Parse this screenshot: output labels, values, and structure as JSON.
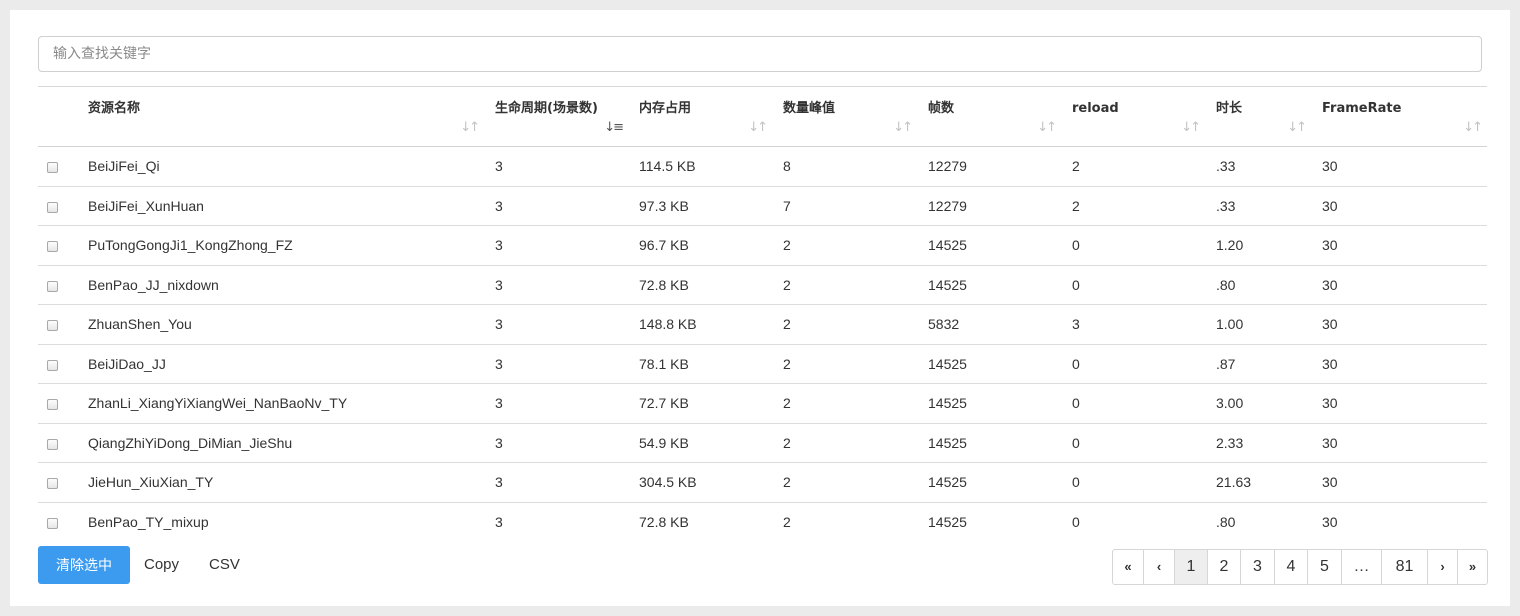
{
  "search": {
    "placeholder": "输入查找关键字"
  },
  "columns": [
    {
      "label": "资源名称"
    },
    {
      "label": "生命周期(场景数)"
    },
    {
      "label": "内存占用"
    },
    {
      "label": "数量峰值"
    },
    {
      "label": "帧数"
    },
    {
      "label": "reload"
    },
    {
      "label": "时长"
    },
    {
      "label": "FrameRate"
    }
  ],
  "sort_glyph": "↓↑",
  "sort_active_glyph": "↓≡",
  "rows": [
    {
      "name": "BeiJiFei_Qi",
      "lifecycle": "3",
      "memory": "114.5 KB",
      "peak": "8",
      "frames": "12279",
      "reload": "2",
      "duration": ".33",
      "framerate": "30",
      "selected": false
    },
    {
      "name": "BeiJiFei_XunHuan",
      "lifecycle": "3",
      "memory": "97.3 KB",
      "peak": "7",
      "frames": "12279",
      "reload": "2",
      "duration": ".33",
      "framerate": "30",
      "selected": false
    },
    {
      "name": "PuTongGongJi1_KongZhong_FZ",
      "lifecycle": "3",
      "memory": "96.7 KB",
      "peak": "2",
      "frames": "14525",
      "reload": "0",
      "duration": "1.20",
      "framerate": "30",
      "selected": false
    },
    {
      "name": "BenPao_JJ_nixdown",
      "lifecycle": "3",
      "memory": "72.8 KB",
      "peak": "2",
      "frames": "14525",
      "reload": "0",
      "duration": ".80",
      "framerate": "30",
      "selected": false
    },
    {
      "name": "ZhuanShen_You",
      "lifecycle": "3",
      "memory": "148.8 KB",
      "peak": "2",
      "frames": "5832",
      "reload": "3",
      "duration": "1.00",
      "framerate": "30",
      "selected": false
    },
    {
      "name": "BeiJiDao_JJ",
      "lifecycle": "3",
      "memory": "78.1 KB",
      "peak": "2",
      "frames": "14525",
      "reload": "0",
      "duration": ".87",
      "framerate": "30",
      "selected": false
    },
    {
      "name": "ZhanLi_XiangYiXiangWei_NanBaoNv_TY",
      "lifecycle": "3",
      "memory": "72.7 KB",
      "peak": "2",
      "frames": "14525",
      "reload": "0",
      "duration": "3.00",
      "framerate": "30",
      "selected": false
    },
    {
      "name": "QiangZhiYiDong_DiMian_JieShu",
      "lifecycle": "3",
      "memory": "54.9 KB",
      "peak": "2",
      "frames": "14525",
      "reload": "0",
      "duration": "2.33",
      "framerate": "30",
      "selected": false
    },
    {
      "name": "JieHun_XiuXian_TY",
      "lifecycle": "3",
      "memory": "304.5 KB",
      "peak": "2",
      "frames": "14525",
      "reload": "0",
      "duration": "21.63",
      "framerate": "30",
      "selected": false
    },
    {
      "name": "BenPao_TY_mixup",
      "lifecycle": "3",
      "memory": "72.8 KB",
      "peak": "2",
      "frames": "14525",
      "reload": "0",
      "duration": ".80",
      "framerate": "30",
      "selected": false
    }
  ],
  "buttons": {
    "clear": "清除选中",
    "copy": "Copy",
    "csv": "CSV"
  },
  "pagination": {
    "first": "«",
    "prev": "‹",
    "pages": [
      "1",
      "2",
      "3",
      "4",
      "5"
    ],
    "ellipsis": "…",
    "last_page": "81",
    "next": "›",
    "last": "»",
    "current": "1"
  },
  "colors": {
    "primary": "#3c9bef",
    "border": "#d6d6d6",
    "background": "#ebebeb"
  }
}
